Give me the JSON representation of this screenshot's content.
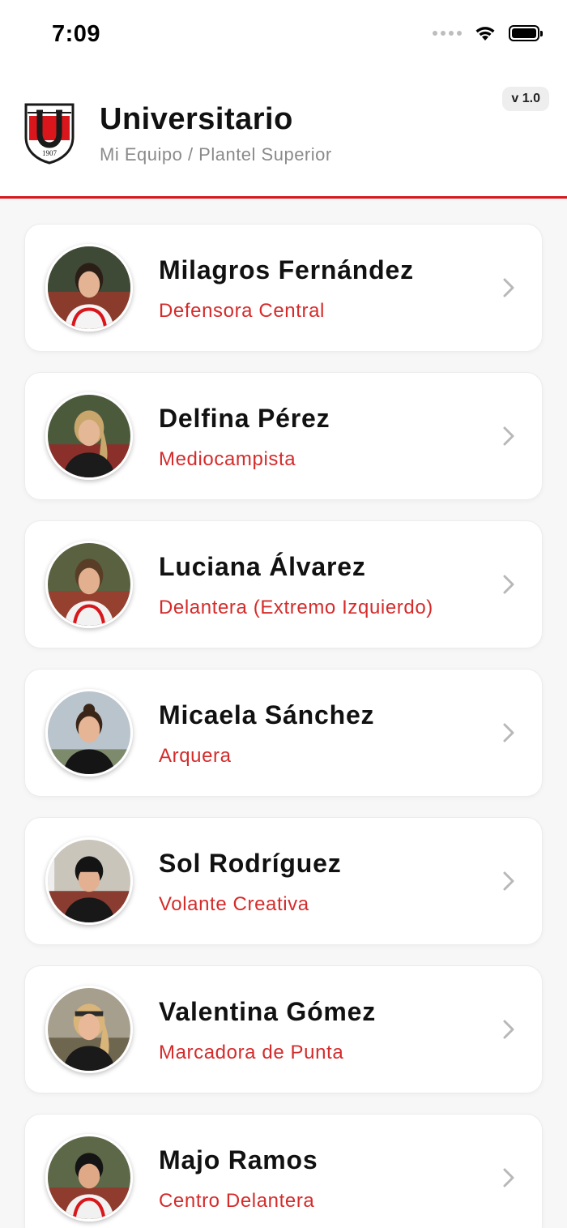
{
  "status_bar": {
    "time": "7:09",
    "icons": [
      "cellular-signal-icon",
      "wifi-icon",
      "battery-icon"
    ]
  },
  "header": {
    "title": "Universitario",
    "subtitle": "Mi Equipo / Plantel Superior",
    "version": "v 1.0",
    "logo_year": "1907",
    "logo_letter": "U"
  },
  "colors": {
    "accent": "#d8161b",
    "position_text": "#d52b2b",
    "chevron": "#b8b8b8"
  },
  "players": [
    {
      "name": "Milagros Fernández",
      "position": "Defensora Central"
    },
    {
      "name": "Delfina Pérez",
      "position": "Mediocampista"
    },
    {
      "name": "Luciana Álvarez",
      "position": "Delantera (Extremo Izquierdo)"
    },
    {
      "name": "Micaela Sánchez",
      "position": "Arquera"
    },
    {
      "name": "Sol Rodríguez",
      "position": "Volante Creativa"
    },
    {
      "name": "Valentina Gómez",
      "position": "Marcadora de Punta"
    },
    {
      "name": "Majo Ramos",
      "position": "Centro Delantera"
    }
  ]
}
